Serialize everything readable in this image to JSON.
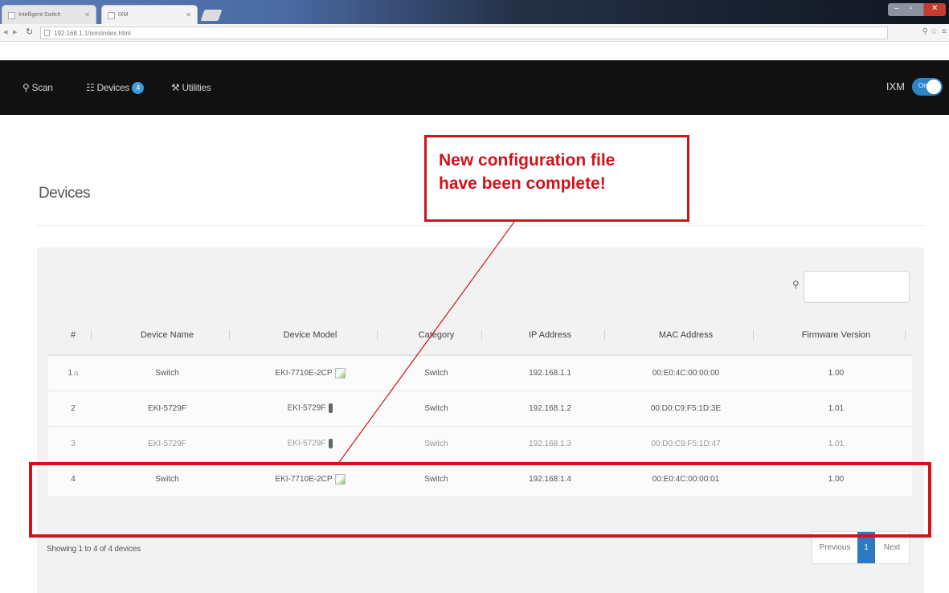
{
  "browser": {
    "tabs": [
      {
        "label": "Intelligent Switch"
      },
      {
        "label": "IXM"
      }
    ],
    "url": "192.168.1.1/ixm/index.html"
  },
  "nav": {
    "scan": "Scan",
    "devices": "Devices",
    "devices_count": "4",
    "utilities": "Utilities",
    "ixm_label": "IXM",
    "toggle_label": "On"
  },
  "page": {
    "title": "Devices"
  },
  "table": {
    "columns": [
      "#",
      "Device Name",
      "Device Model",
      "Category",
      "IP Address",
      "MAC Address",
      "Firmware Version"
    ],
    "rows": [
      {
        "num": "1",
        "name": "Switch",
        "model": "EKI-7710E-2CP",
        "category": "Switch",
        "ip": "192.168.1.1",
        "mac": "00:E0:4C:00:00:00",
        "fw": "1.00"
      },
      {
        "num": "2",
        "name": "EKI-5729F",
        "model": "EKI-5729F",
        "category": "Switch",
        "ip": "192.168.1.2",
        "mac": "00:D0:C9:F5:1D:3E",
        "fw": "1.01"
      },
      {
        "num": "3",
        "name": "EKI-5729F",
        "model": "EKI-5729F",
        "category": "Switch",
        "ip": "192.168.1.3",
        "mac": "00:D0:C9:F5:1D:47",
        "fw": "1.01"
      },
      {
        "num": "4",
        "name": "Switch",
        "model": "EKI-7710E-2CP",
        "category": "Switch",
        "ip": "192.168.1.4",
        "mac": "00:E0:4C:00:00:01",
        "fw": "1.00"
      }
    ]
  },
  "footer": {
    "showing": "Showing 1 to 4 of 4 devices",
    "previous": "Previous",
    "page": "1",
    "next": "Next"
  },
  "annotation": {
    "line1": "New configuration file",
    "line2": "have been complete!",
    "color": "#d0141b"
  }
}
